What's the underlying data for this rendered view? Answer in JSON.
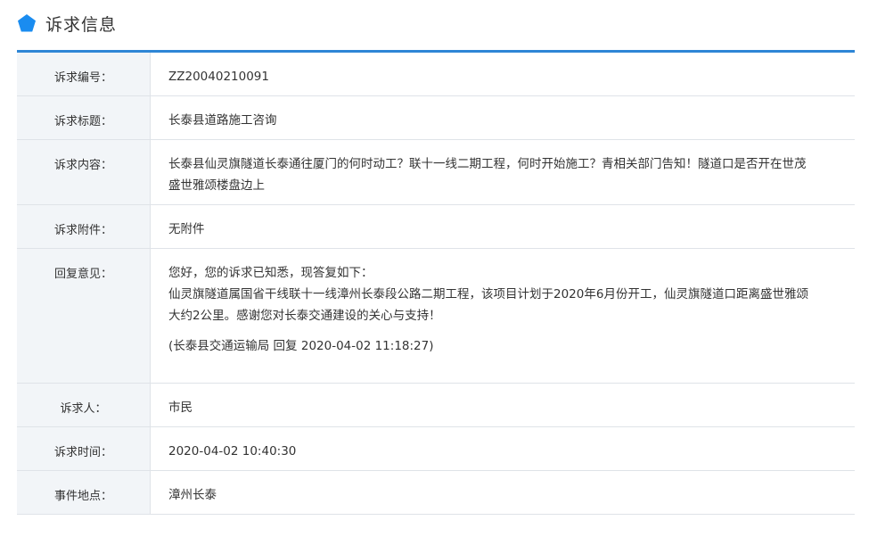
{
  "header": {
    "title": "诉求信息",
    "icon": "pentagon-icon",
    "icon_color": "#1a8cf0"
  },
  "accent_color": "#2e86d6",
  "rows": [
    {
      "label": "诉求编号：",
      "value": "ZZ20040210091"
    },
    {
      "label": "诉求标题：",
      "value": "长泰县道路施工咨询"
    },
    {
      "label": "诉求内容：",
      "lines": [
        "长泰县仙灵旗隧道长泰通往厦门的何时动工？联十一线二期工程，何时开始施工？青相关部门告知！隧道口是否开在世茂",
        "盛世雅颂楼盘边上"
      ]
    },
    {
      "label": "诉求附件：",
      "value": "无附件"
    },
    {
      "label": "回复意见：",
      "lines": [
        "您好，您的诉求已知悉，现答复如下：",
        "仙灵旗隧道属国省干线联十一线漳州长泰段公路二期工程，该项目计划于2020年6月份开工，仙灵旗隧道口距离盛世雅颂",
        "大约2公里。感谢您对长泰交通建设的关心与支持！"
      ],
      "meta": "(长泰县交通运输局 回复 2020-04-02 11:18:27)"
    },
    {
      "label": "诉求人：",
      "value": "市民"
    },
    {
      "label": "诉求时间：",
      "value": "2020-04-02 10:40:30"
    },
    {
      "label": "事件地点：",
      "value": "漳州长泰"
    }
  ]
}
